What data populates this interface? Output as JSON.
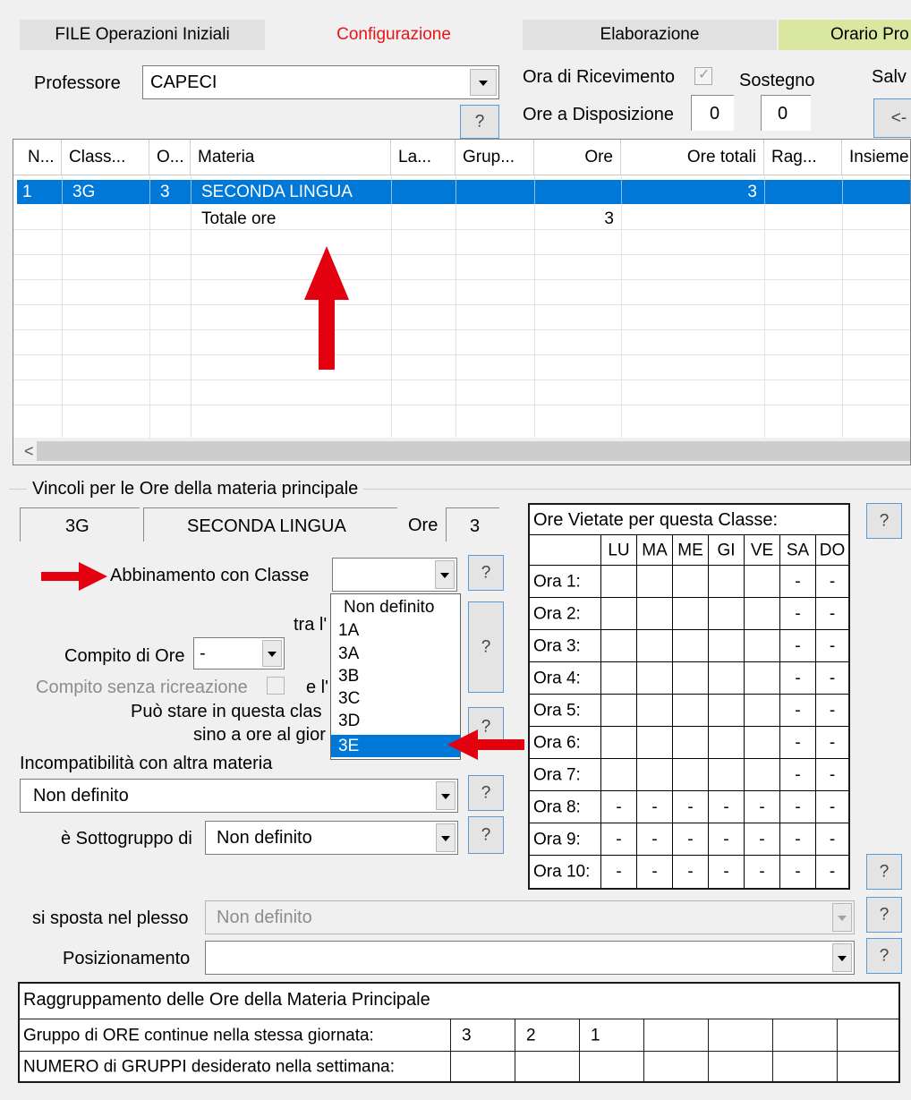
{
  "tabs": [
    "FILE Operazioni Iniziali",
    "Configurazione",
    "Elaborazione",
    "Orario Pro"
  ],
  "professor": {
    "label": "Professore",
    "value": "CAPECI",
    "ricevimento_label": "Ora di Ricevimento",
    "ricevimento_checked": true,
    "sostegno_label": "Sostegno",
    "disposizione_label": "Ore a Disposizione",
    "disposizione_1": "0",
    "disposizione_2": "0",
    "salva_label": "Salv",
    "back_label": "<-"
  },
  "grid": {
    "columns": [
      "N...",
      "Class...",
      "O...",
      "Materia",
      "La...",
      "Grup...",
      "Ore",
      "Ore totali",
      "Rag...",
      "Insieme"
    ],
    "rows": [
      {
        "n": "1",
        "classe": "3G",
        "o": "3",
        "materia": "SECONDA LINGUA",
        "la": "",
        "grup": "",
        "ore": "",
        "ore_totali": "3",
        "rag": "",
        "insieme": ""
      },
      {
        "n": "",
        "classe": "",
        "o": "",
        "materia": "Totale ore",
        "la": "",
        "grup": "",
        "ore": "3",
        "ore_totali": "",
        "rag": "",
        "insieme": ""
      }
    ],
    "scroll_left": "<"
  },
  "vincoli": {
    "title": "Vincoli per le Ore della materia principale",
    "classe": "3G",
    "materia": "SECONDA LINGUA",
    "ore_label": "Ore",
    "ore_value": "3",
    "abbinamento_label": "Abbinamento con Classe",
    "abbinamento_value": "",
    "tra_label": "tra l'",
    "compito_label": "Compito di Ore",
    "compito_value": "-",
    "compito_senza_label": "Compito senza ricreazione",
    "e_label": "e l'",
    "puo_stare_label": "Può stare in questa clas",
    "sino_label": "sino a ore al gior",
    "incompat_label": "Incompatibilità con altra materia",
    "incompat_value": "Non definito",
    "sottogruppo_label": "è Sottogruppo di",
    "sottogruppo_value": "Non definito",
    "plesso_label": "si sposta nel plesso",
    "plesso_value": "Non definito",
    "posiz_label": "Posizionamento",
    "posiz_value": "",
    "q": "?"
  },
  "dropdown_options": [
    "Non definito",
    "1A",
    "3A",
    "3B",
    "3C",
    "3D",
    "3E"
  ],
  "dropdown_selected": "3E",
  "ore_vietate": {
    "title": "Ore Vietate per questa Classe:",
    "days": [
      "LU",
      "MA",
      "ME",
      "GI",
      "VE",
      "SA",
      "DO"
    ],
    "hours": [
      "Ora 1:",
      "Ora 2:",
      "Ora 3:",
      "Ora 4:",
      "Ora 5:",
      "Ora 6:",
      "Ora 7:",
      "Ora 8:",
      "Ora 9:",
      "Ora 10:"
    ],
    "cells": [
      [
        "",
        "",
        "",
        "",
        "",
        "-",
        "-"
      ],
      [
        "",
        "",
        "",
        "",
        "",
        "-",
        "-"
      ],
      [
        "",
        "",
        "",
        "",
        "",
        "-",
        "-"
      ],
      [
        "",
        "",
        "",
        "",
        "",
        "-",
        "-"
      ],
      [
        "",
        "",
        "",
        "",
        "",
        "-",
        "-"
      ],
      [
        "",
        "",
        "",
        "",
        "",
        "-",
        "-"
      ],
      [
        "",
        "",
        "",
        "",
        "",
        "-",
        "-"
      ],
      [
        "-",
        "-",
        "-",
        "-",
        "-",
        "-",
        "-"
      ],
      [
        "-",
        "-",
        "-",
        "-",
        "-",
        "-",
        "-"
      ],
      [
        "-",
        "-",
        "-",
        "-",
        "-",
        "-",
        "-"
      ]
    ]
  },
  "raggruppamento": {
    "title": "Raggruppamento delle Ore della Materia Principale",
    "row1_label": "Gruppo di ORE continue nella stessa giornata:",
    "row1_values": [
      "3",
      "2",
      "1",
      "",
      "",
      "",
      "",
      ""
    ],
    "row2_label": "NUMERO di GRUPPI desiderato nella settimana:",
    "row2_values": [
      "",
      "",
      "",
      "",
      "",
      "",
      "",
      ""
    ]
  },
  "colors": {
    "accent_red": "#e3000f",
    "selection_blue": "#0078d7",
    "tab_active_text": "#e8141a",
    "tab_orario_bg": "#d9e7a0"
  }
}
